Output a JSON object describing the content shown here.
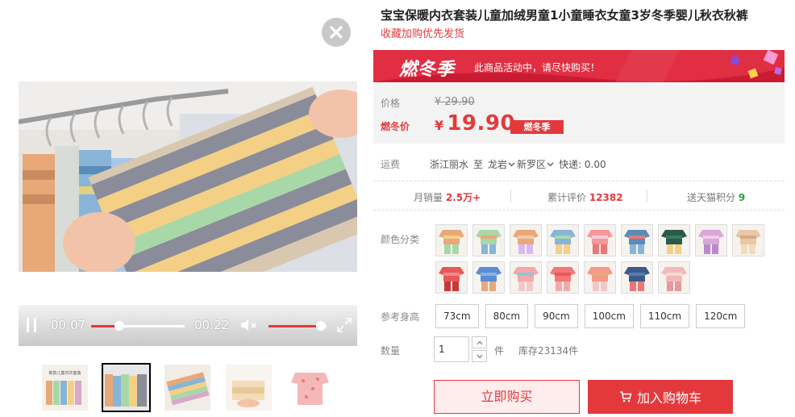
{
  "video": {
    "current_time": "00:07",
    "duration": "00:22",
    "progress": 0.3,
    "volume": 0.9
  },
  "thumbnails": [
    {
      "caption": "新款儿童内衣套装"
    },
    {
      "caption": ""
    },
    {
      "caption": ""
    },
    {
      "caption": ""
    },
    {
      "caption": ""
    }
  ],
  "product": {
    "title": "宝宝保暖内衣套装儿童加绒男童1小童睡衣女童3岁冬季婴儿秋衣秋裤",
    "subtitle": "收藏加购优先发货"
  },
  "promo": {
    "logo": "燃冬季",
    "text": "此商品活动中，请尽快购买！"
  },
  "price": {
    "orig_label": "价格",
    "orig_price": "¥ 29.90",
    "sale_label": "燃冬价",
    "currency": "¥",
    "sale_price": "19.90",
    "tag": "燃冬季"
  },
  "shipping": {
    "label": "运费",
    "from": "浙江丽水",
    "to_word": "至",
    "city": "龙岩",
    "district": "新罗区",
    "express": "快递: 0.00"
  },
  "stats": {
    "monthly_label": "月销量",
    "monthly_value": "2.5万+",
    "reviews_label": "累计评价",
    "reviews_value": "12382",
    "points_label": "送天猫积分",
    "points_value": "9"
  },
  "color_label": "颜色分类",
  "height_label": "参考身高",
  "sizes": [
    "73cm",
    "80cm",
    "90cm",
    "100cm",
    "110cm",
    "120cm"
  ],
  "quantity": {
    "label": "数量",
    "value": "1",
    "unit": "件",
    "stock": "库存23134件"
  },
  "buttons": {
    "buy_now": "立即购买",
    "add_cart": "加入购物车"
  },
  "colors": {
    "accent": "#e4393c",
    "promo_bg": "#e02e43",
    "green": "#2f9c32"
  }
}
